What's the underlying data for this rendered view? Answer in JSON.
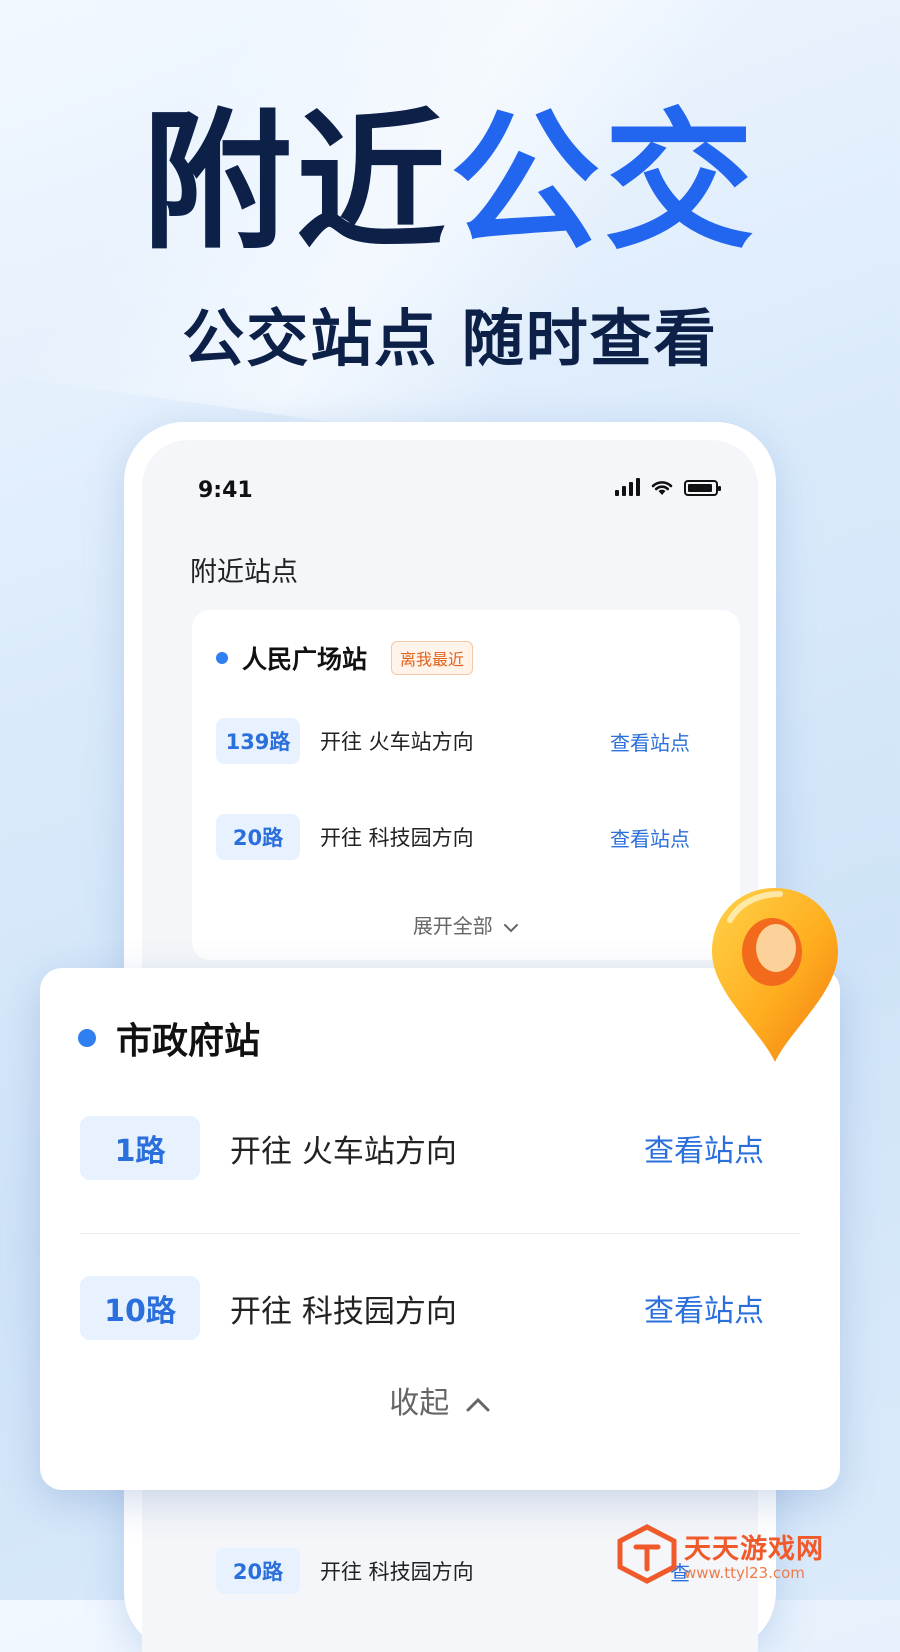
{
  "hero": {
    "title_dark": "附近",
    "title_blue": "公交",
    "subtitle": "公交站点 随时查看"
  },
  "status_bar": {
    "time": "9:41",
    "icons": [
      "signal-icon",
      "wifi-icon",
      "battery-icon"
    ]
  },
  "nearby": {
    "section_title": "附近站点",
    "station": {
      "name": "人民广场站",
      "badge": "离我最近",
      "routes": [
        {
          "route": "139路",
          "direction": "开往 火车站方向",
          "action": "查看站点"
        },
        {
          "route": "20路",
          "direction": "开往 科技园方向",
          "action": "查看站点"
        }
      ],
      "expand_label": "展开全部"
    }
  },
  "featured_card": {
    "station_name": "市政府站",
    "routes": [
      {
        "route": "1路",
        "direction": "开往 火车站方向",
        "action": "查看站点"
      },
      {
        "route": "10路",
        "direction": "开往 科技园方向",
        "action": "查看站点"
      }
    ],
    "collapse_label": "收起"
  },
  "background_rows": [
    {
      "route": "20路",
      "direction": "开往 科技园方向",
      "action": "查"
    }
  ],
  "watermark": {
    "name": "天天游戏网",
    "url": "www.ttyl23.com"
  },
  "colors": {
    "accent": "#2266f0",
    "title_dark": "#0d2148",
    "badge_orange": "#e0641e"
  }
}
